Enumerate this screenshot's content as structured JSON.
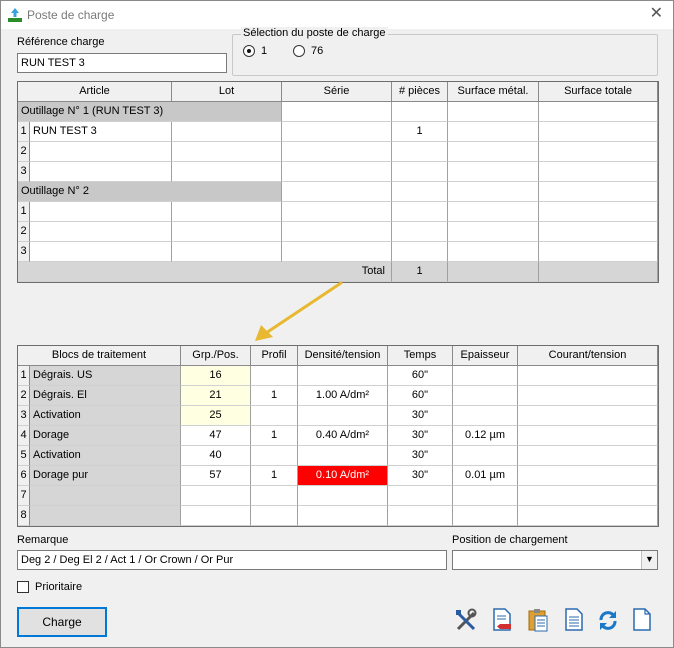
{
  "window": {
    "title": "Poste de charge",
    "close_glyph": "✕"
  },
  "reference": {
    "label": "Référence charge",
    "value": "RUN TEST 3"
  },
  "station": {
    "label": "Sélection du poste de charge",
    "options": [
      {
        "label": "1",
        "selected": true
      },
      {
        "label": "76",
        "selected": false
      }
    ]
  },
  "articles": {
    "columns": [
      "Article",
      "Lot",
      "Série",
      "# pièces",
      "Surface métal.",
      "Surface totale"
    ],
    "groups": [
      {
        "title": "Outillage N° 1  (RUN TEST 3)",
        "rows": [
          {
            "num": "1",
            "article": "RUN TEST 3",
            "lot": "",
            "serie": "",
            "pieces": "1",
            "surf_metal": "",
            "surf_total": ""
          },
          {
            "num": "2",
            "article": "",
            "lot": "",
            "serie": "",
            "pieces": "",
            "surf_metal": "",
            "surf_total": ""
          },
          {
            "num": "3",
            "article": "",
            "lot": "",
            "serie": "",
            "pieces": "",
            "surf_metal": "",
            "surf_total": ""
          }
        ]
      },
      {
        "title": "Outillage N° 2",
        "rows": [
          {
            "num": "1",
            "article": "",
            "lot": "",
            "serie": "",
            "pieces": "",
            "surf_metal": "",
            "surf_total": ""
          },
          {
            "num": "2",
            "article": "",
            "lot": "",
            "serie": "",
            "pieces": "",
            "surf_metal": "",
            "surf_total": ""
          },
          {
            "num": "3",
            "article": "",
            "lot": "",
            "serie": "",
            "pieces": "",
            "surf_metal": "",
            "surf_total": ""
          }
        ]
      }
    ],
    "total": {
      "label": "Total",
      "pieces": "1"
    }
  },
  "blocs": {
    "columns": [
      "Blocs de traitement",
      "Grp./Pos.",
      "Profil",
      "Densité/tension",
      "Temps",
      "Epaisseur",
      "Courant/tension"
    ],
    "rows": [
      {
        "num": "1",
        "name": "Dégrais. US",
        "grp": "16",
        "profil": "",
        "densite": "",
        "temps": "60\"",
        "epaisseur": "",
        "courant": ""
      },
      {
        "num": "2",
        "name": "Dégrais. El",
        "grp": "21",
        "profil": "1",
        "densite": "1.00 A/dm²",
        "temps": "60\"",
        "epaisseur": "",
        "courant": ""
      },
      {
        "num": "3",
        "name": "Activation",
        "grp": "25",
        "profil": "",
        "densite": "",
        "temps": "30\"",
        "epaisseur": "",
        "courant": ""
      },
      {
        "num": "4",
        "name": "Dorage",
        "grp": "47",
        "profil": "1",
        "densite": "0.40 A/dm²",
        "temps": "30\"",
        "epaisseur": "0.12 µm",
        "courant": ""
      },
      {
        "num": "5",
        "name": "Activation",
        "grp": "40",
        "profil": "",
        "densite": "",
        "temps": "30\"",
        "epaisseur": "",
        "courant": ""
      },
      {
        "num": "6",
        "name": "Dorage pur",
        "grp": "57",
        "profil": "1",
        "densite": "0.10 A/dm²",
        "temps": "30\"",
        "epaisseur": "0.01 µm",
        "courant": ""
      },
      {
        "num": "7",
        "name": "",
        "grp": "",
        "profil": "",
        "densite": "",
        "temps": "",
        "epaisseur": "",
        "courant": ""
      },
      {
        "num": "8",
        "name": "",
        "grp": "",
        "profil": "",
        "densite": "",
        "temps": "",
        "epaisseur": "",
        "courant": ""
      }
    ]
  },
  "remarque": {
    "label": "Remarque",
    "value": "Deg 2 / Deg El 2 / Act 1 / Or Crown / Or Pur"
  },
  "position": {
    "label": "Position de chargement",
    "value": ""
  },
  "prioritaire": {
    "label": "Prioritaire",
    "checked": false
  },
  "charge_button": {
    "label": "Charge"
  },
  "colors": {
    "highlight_red": "#ff0000",
    "arrow": "#e8b830",
    "grp_yellow": "#ffffe1"
  },
  "toolbar_icons": [
    "tools-icon",
    "remove-document-icon",
    "clipboard-icon",
    "document-list-icon",
    "refresh-icon",
    "new-document-icon"
  ]
}
